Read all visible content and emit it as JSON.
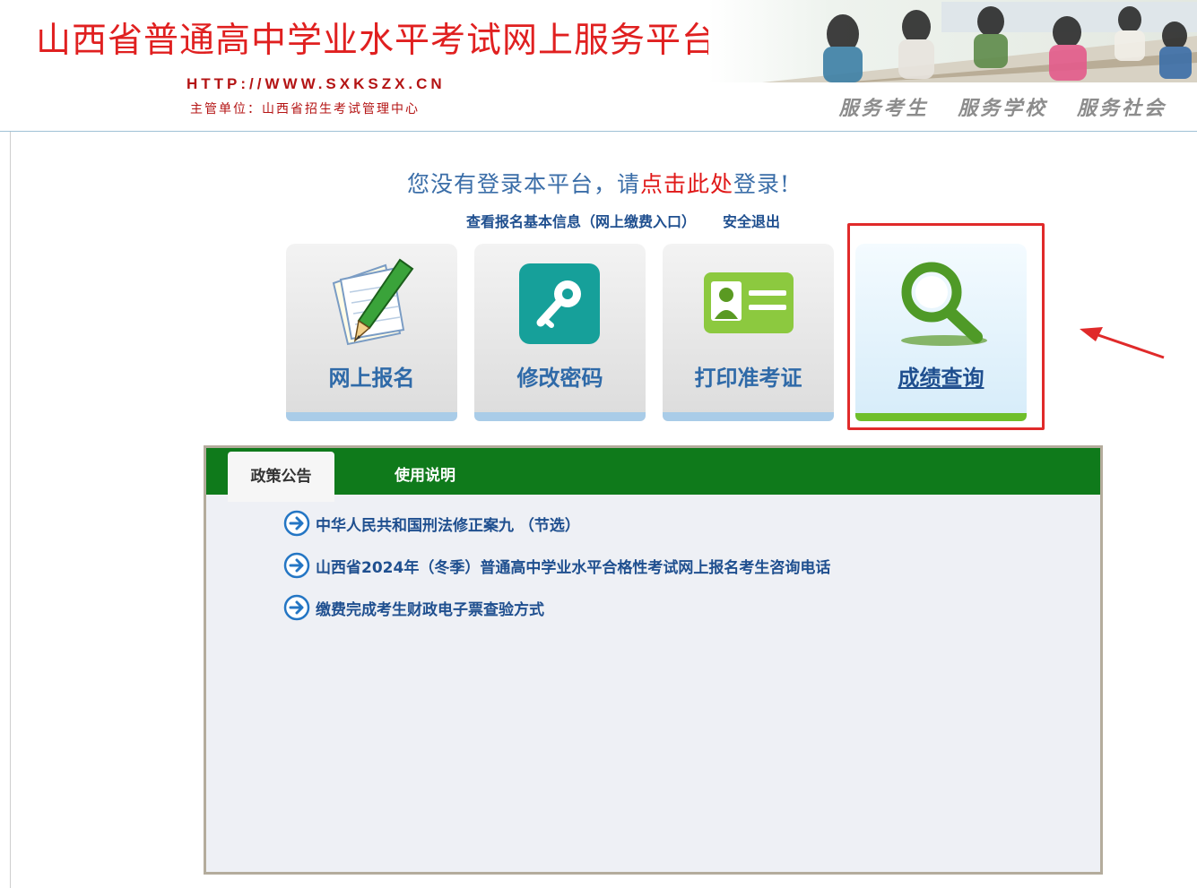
{
  "header": {
    "title": "山西省普通高中学业水平考试网上服务平台",
    "url": "HTTP://WWW.SXKSZX.CN",
    "org": "主管单位：山西省招生考试管理中心",
    "slogans": [
      "服务考生",
      "服务学校",
      "服务社会"
    ]
  },
  "login": {
    "prefix": "您没有登录本平台，请",
    "link": "点击此处",
    "suffix": "登录!",
    "view_info_link": "查看报名基本信息（网上缴费入口）",
    "logout_link": "安全退出"
  },
  "tiles": [
    {
      "label": "网上报名",
      "icon": "pencil-paper-icon"
    },
    {
      "label": "修改密码",
      "icon": "key-icon"
    },
    {
      "label": "打印准考证",
      "icon": "id-card-icon"
    },
    {
      "label": "成绩查询",
      "icon": "magnifier-icon"
    }
  ],
  "panel": {
    "tabs": [
      "政策公告",
      "使用说明"
    ],
    "news": [
      "中华人民共和国刑法修正案九 （节选）",
      "山西省2024年（冬季）普通高中学业水平合格性考试网上报名考生咨询电话",
      "缴费完成考生财政电子票查验方式"
    ]
  },
  "colors": {
    "title_red": "#e02020",
    "link_blue": "#1f4f8f",
    "tab_green": "#0f7a1b",
    "highlight_red": "#e02a2a"
  }
}
